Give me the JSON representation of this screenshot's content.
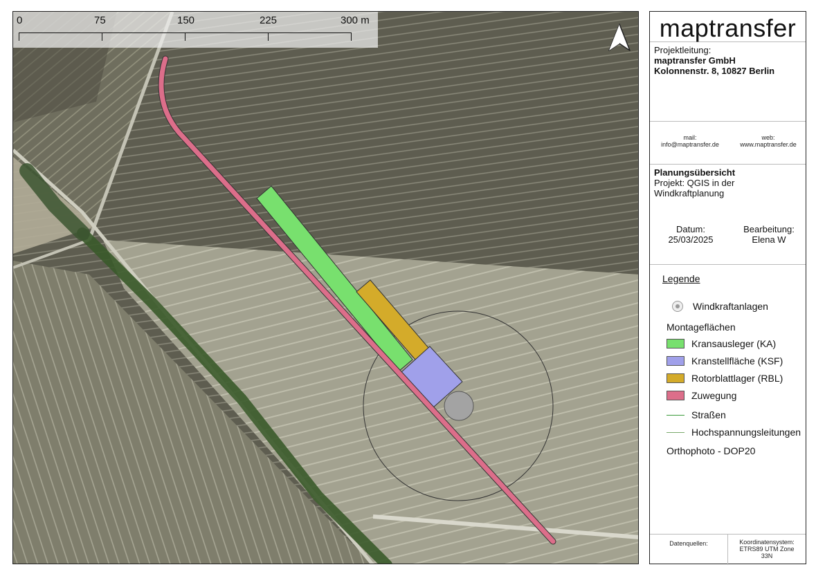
{
  "map": {
    "scale": {
      "labels": [
        "0",
        "75",
        "150",
        "225",
        "300 m"
      ]
    },
    "north_arrow_icon": "north-arrow-icon"
  },
  "panel": {
    "brand": "maptransfer",
    "project_lead_label": "Projektleitung:",
    "company": "maptransfer GmbH",
    "address": "Kolonnenstr. 8, 10827 Berlin",
    "mail_label": "mail:",
    "mail": "info@maptransfer.de",
    "web_label": "web:",
    "web": "www.maptransfer.de",
    "plan_title": "Planungsübersicht",
    "project_line1": "Projekt: QGIS in der",
    "project_line2": "Windkraftplanung",
    "date_label": "Datum:",
    "date": "25/03/2025",
    "editor_label": "Bearbeitung:",
    "editor": "Elena W",
    "legend_title": "Legende",
    "legend": {
      "windkraft": "Windkraftanlagen",
      "group": "Montageflächen",
      "kransausleger": "Kransausleger (KA)",
      "kranstell": "Kranstellfläche (KSF)",
      "rotorblatt": "Rotorblattlager (RBL)",
      "zuwegung": "Zuwegung",
      "strassen": "Straßen",
      "hochspannung": "Hochspannungsleitungen",
      "ortho": "Orthophoto - DOP20"
    },
    "datasources_label": "Datenquellen:",
    "crs_line1": "Koordinatensystem:",
    "crs_line2": "ETRS89 UTM Zone",
    "crs_line3": "33N"
  },
  "colors": {
    "kransausleger": "#78e06e",
    "kranstell": "#a0a0ea",
    "rotorblatt": "#d4ab2a",
    "zuwegung": "#dc6e8a",
    "strassen": "#3a9a3a"
  }
}
